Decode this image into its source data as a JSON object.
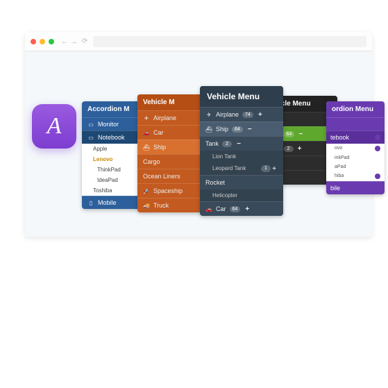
{
  "app_icon_letter": "A",
  "panelA": {
    "title": "Accordion M",
    "items": [
      "Monitor",
      "Notebook"
    ],
    "subs": [
      "Apple",
      "Lenovo",
      "ThinkPad",
      "IdeaPad",
      "Toshiba"
    ],
    "mobile": "Mobile"
  },
  "panelB": {
    "title": "Vehicle M",
    "items": [
      "Airplane",
      "Car",
      "Ship",
      "Cargo",
      "Ocean Liners",
      "Spaceship",
      "Truck"
    ]
  },
  "panelC": {
    "title": "Vehicle Menu",
    "airplane": {
      "label": "Airplane",
      "badge": "74"
    },
    "ship": {
      "label": "Ship",
      "badge": "64"
    },
    "tank": {
      "label": "Tank",
      "badge": "2",
      "subs": [
        "Lion Tank",
        "Leopard Tank"
      ],
      "subbadge": "1"
    },
    "rocket": {
      "label": "Rocket",
      "subs": [
        "Helicopter"
      ]
    },
    "car": {
      "label": "Car",
      "badge": "64"
    }
  },
  "panelD": {
    "title": "icle Menu",
    "badge1": "64",
    "badge2": "2"
  },
  "panelE": {
    "title": "ordion Menu",
    "top": "tebook",
    "subs": [
      "ovo",
      "inkPad",
      "aPad",
      "hiba"
    ],
    "bile": "bile"
  }
}
